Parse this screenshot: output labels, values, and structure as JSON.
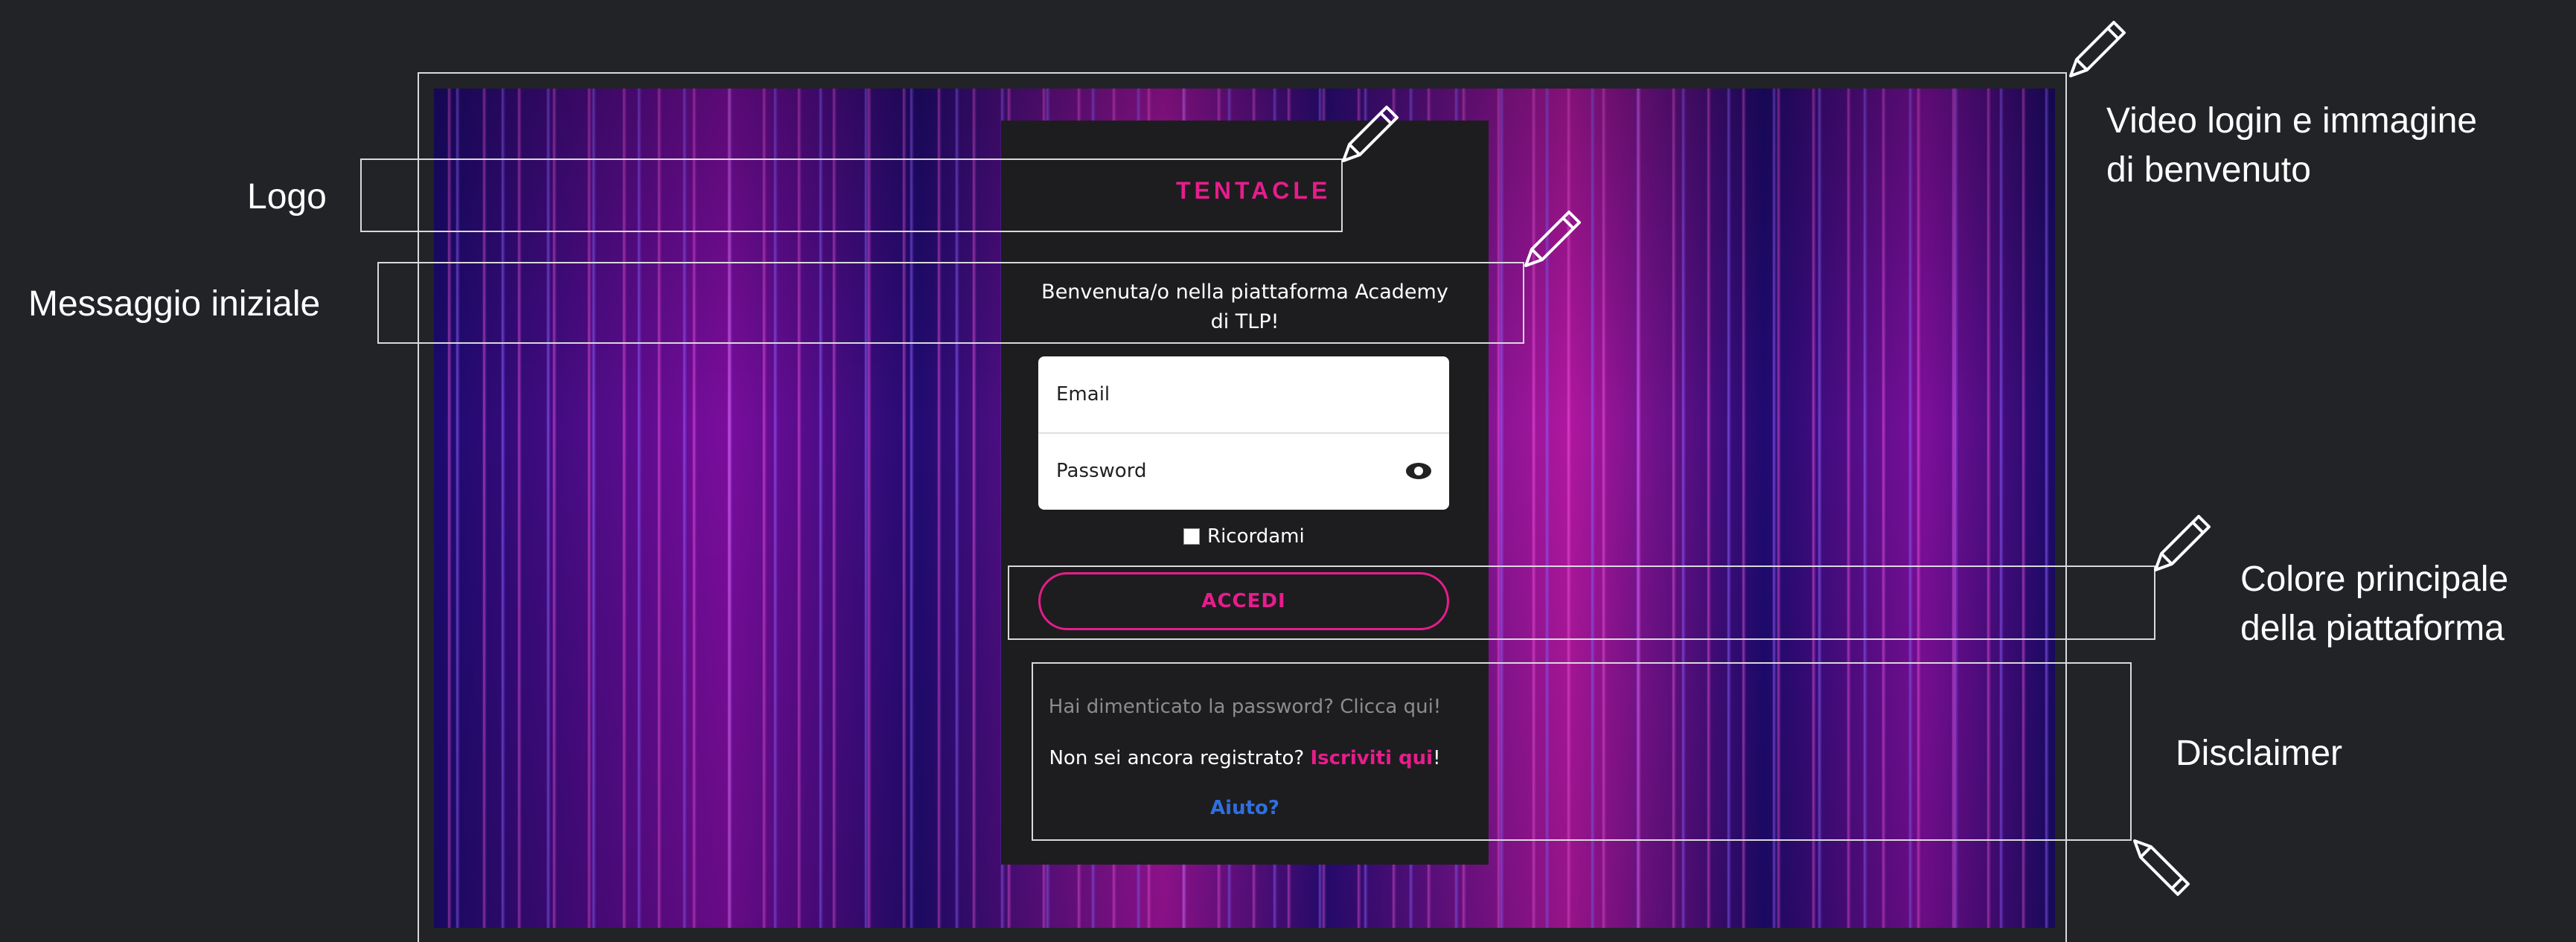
{
  "annotations": {
    "logo": "Logo",
    "initial_message": "Messaggio iniziale",
    "video_line1": "Video login e immagine",
    "video_line2": "di benvenuto",
    "color_line1": "Colore principale",
    "color_line2": "della piattaforma",
    "disclaimer": "Disclaimer"
  },
  "login": {
    "brand": "TENTACLE",
    "welcome": "Benvenuta/o nella piattaforma Academy di TLP!",
    "email_placeholder": "Email",
    "password_placeholder": "Password",
    "remember": "Ricordami",
    "submit": "ACCEDI",
    "forgot": "Hai dimenticato la password? Clicca qui!",
    "register_prefix": "Non sei ancora registrato?",
    "register_link": "Iscriviti qui",
    "register_suffix": "!",
    "help": "Aiuto?"
  },
  "colors": {
    "background": "#212327",
    "accent": "#e61d8c",
    "help_link": "#2f6fe0",
    "panel": "#1d1d1f"
  },
  "icons": [
    "pencil-icon",
    "eye-icon"
  ]
}
